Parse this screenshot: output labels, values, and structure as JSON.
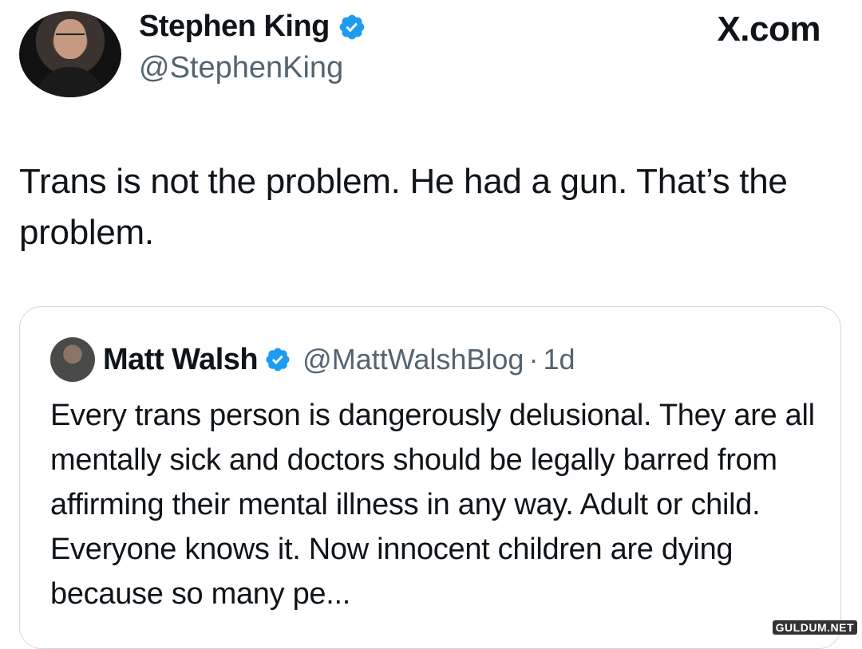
{
  "author": {
    "name": "Stephen King",
    "handle": "@StephenKing",
    "verified": true
  },
  "brand": "X.com",
  "tweet": {
    "text": "Trans is not the problem. He had a gun. That’s the problem."
  },
  "quote": {
    "name": "Matt Walsh",
    "handle": "@MattWalshBlog",
    "separator": "·",
    "time": "1d",
    "verified": true,
    "text": "Every trans person is dangerously delusional. They are all mentally sick and doctors should be legally barred from affirming their mental illness in any way. Adult or child. Everyone knows it. Now innocent children are dying because so many pe..."
  },
  "watermark": "GULDUM.NET",
  "colors": {
    "verified": "#1d9bf0",
    "secondary_text": "#536471",
    "border": "#cfd9de"
  }
}
